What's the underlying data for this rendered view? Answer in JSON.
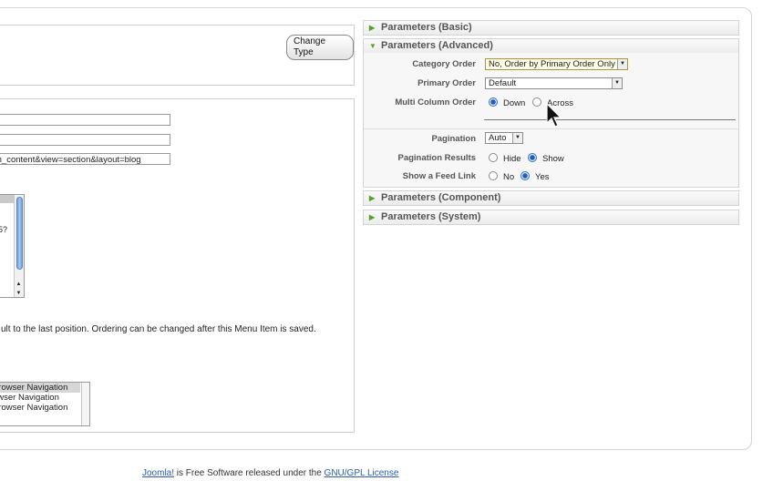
{
  "type_section": {
    "change_type_button": "Change Type"
  },
  "details_section": {
    "link_value": "m_content&view=section&layout=blog",
    "list_partial_question": "5?",
    "ordering_note": "ult to the last position. Ordering can be changed after this Menu Item is saved.",
    "target_window_options": [
      "Browser Navigation",
      "owser Navigation",
      " Browser Navigation"
    ]
  },
  "parameters": {
    "basic": {
      "title": "Parameters (Basic)"
    },
    "advanced": {
      "title": "Parameters (Advanced)",
      "category_order": {
        "label": "Category Order",
        "value": "No, Order by Primary Order Only"
      },
      "primary_order": {
        "label": "Primary Order",
        "value": "Default"
      },
      "multi_column_order": {
        "label": "Multi Column Order",
        "options": [
          "Down",
          "Across"
        ],
        "selected": "Down"
      },
      "pagination": {
        "label": "Pagination",
        "value": "Auto"
      },
      "pagination_results": {
        "label": "Pagination Results",
        "options": [
          "Hide",
          "Show"
        ],
        "selected": "Show"
      },
      "show_feed_link": {
        "label": "Show a Feed Link",
        "options": [
          "No",
          "Yes"
        ],
        "selected": "Yes"
      }
    },
    "component": {
      "title": "Parameters (Component)"
    },
    "system": {
      "title": "Parameters (System)"
    }
  },
  "footer": {
    "brand_link": "Joomla!",
    "text": " is Free Software released under the ",
    "license_link": "GNU/GPL License"
  },
  "colors": {
    "accent_green": "#5aa02c",
    "radio_blue": "#1e5fb8",
    "link_blue": "#2a5db0"
  }
}
